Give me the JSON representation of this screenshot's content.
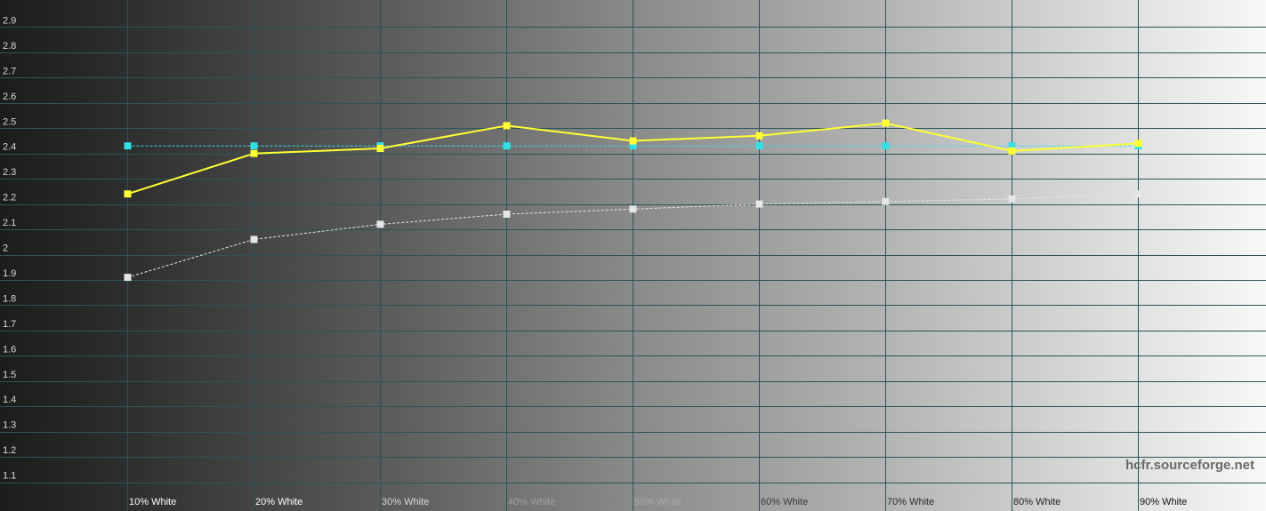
{
  "chart_data": {
    "type": "line",
    "categories": [
      "10% White",
      "20% White",
      "30% White",
      "40% White",
      "50% White",
      "60% White",
      "70% White",
      "80% White",
      "90% White"
    ],
    "y_ticks": [
      "1.1",
      "1.2",
      "1.3",
      "1.4",
      "1.5",
      "1.6",
      "1.7",
      "1.8",
      "1.9",
      "2",
      "2.1",
      "2.2",
      "2.3",
      "2.4",
      "2.5",
      "2.6",
      "2.7",
      "2.8",
      "2.9"
    ],
    "ylim": [
      1.0,
      3.0
    ],
    "grid": true,
    "series": [
      {
        "color": "#ffff33",
        "style": "solid",
        "values": [
          2.24,
          2.4,
          2.42,
          2.51,
          2.45,
          2.47,
          2.52,
          2.41,
          2.44
        ]
      },
      {
        "color": "#33e0e8",
        "style": "dashed",
        "values": [
          2.43,
          2.43,
          2.43,
          2.43,
          2.43,
          2.43,
          2.43,
          2.43,
          2.43
        ]
      },
      {
        "color": "#e6e6e6",
        "style": "dashed",
        "values": [
          1.91,
          2.06,
          2.12,
          2.16,
          2.18,
          2.2,
          2.21,
          2.22,
          2.24
        ]
      }
    ],
    "watermark": "hcfr.sourceforge.net"
  },
  "colors": {
    "grid": "#2a5559",
    "background_start": "#1c1c1c",
    "background_end": "#f6f6f6"
  }
}
